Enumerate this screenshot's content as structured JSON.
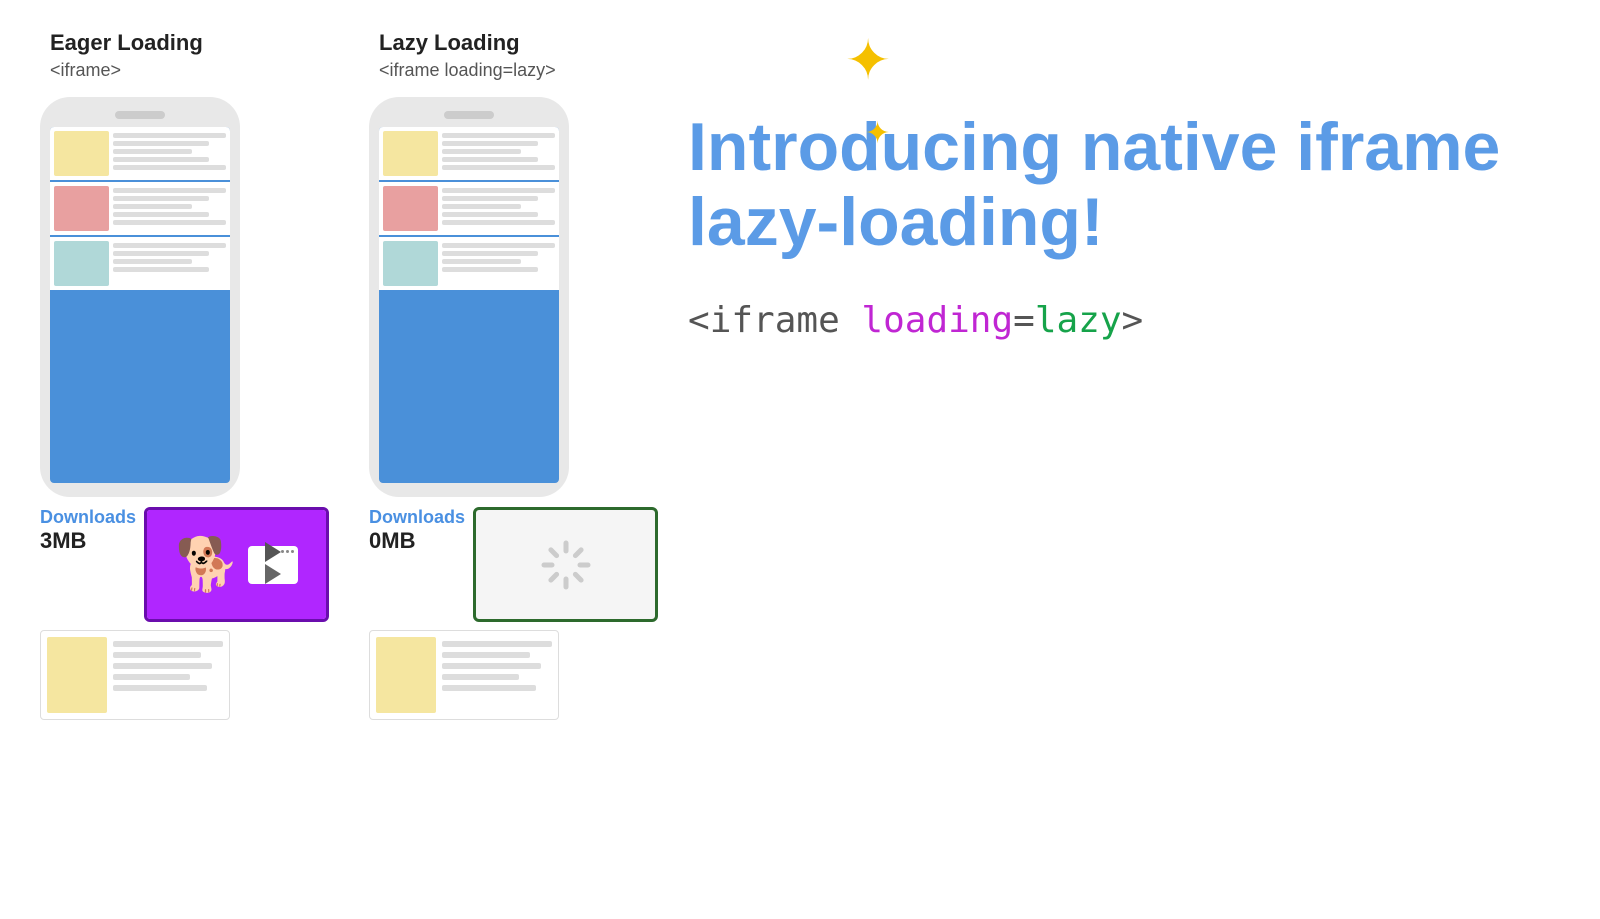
{
  "eager": {
    "title": "Eager Loading",
    "subtitle": "<iframe>",
    "downloads_label": "Downloads",
    "downloads_size": "3MB"
  },
  "lazy": {
    "title": "Lazy Loading",
    "subtitle": "<iframe loading=lazy>",
    "downloads_label": "Downloads",
    "downloads_size": "0MB"
  },
  "intro": {
    "title": "Introducing native iframe lazy-loading!",
    "code_prefix": "<iframe ",
    "code_attr": "loading",
    "code_equals": "=",
    "code_value": "lazy",
    "code_suffix": ">"
  },
  "sparkle": "✦"
}
